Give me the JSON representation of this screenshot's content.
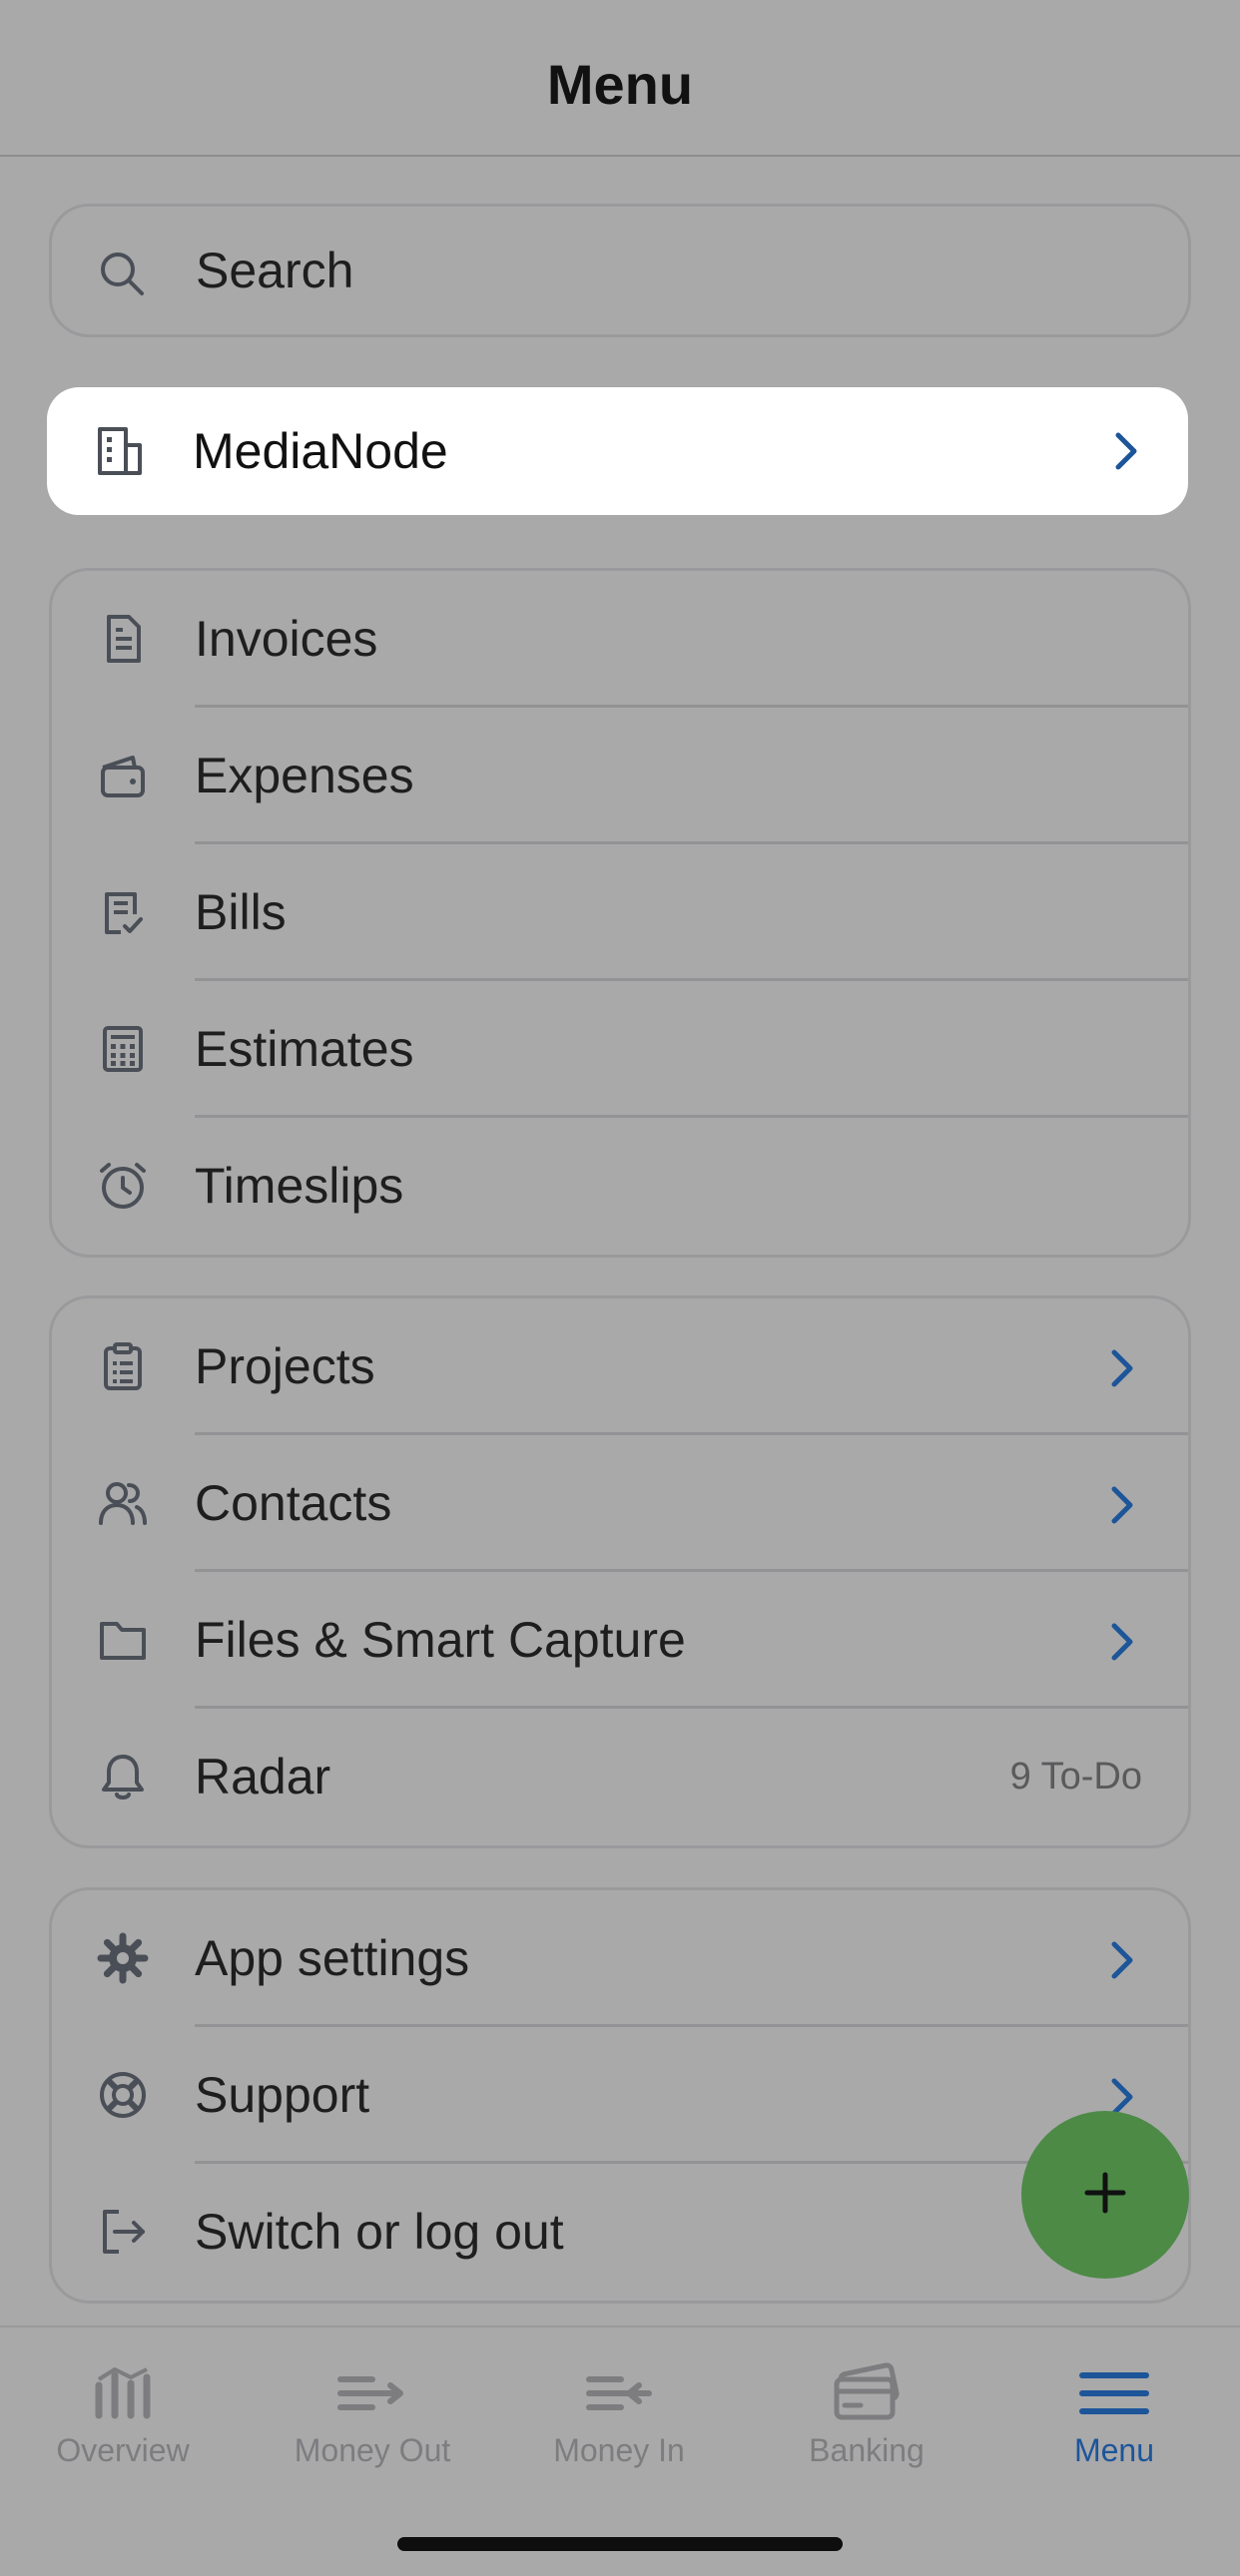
{
  "header": {
    "title": "Menu"
  },
  "search": {
    "label": "Search"
  },
  "organization": {
    "label": "MediaNode"
  },
  "groups": {
    "finance": [
      {
        "label": "Invoices"
      },
      {
        "label": "Expenses"
      },
      {
        "label": "Bills"
      },
      {
        "label": "Estimates"
      },
      {
        "label": "Timeslips"
      }
    ],
    "workspace": [
      {
        "label": "Projects"
      },
      {
        "label": "Contacts"
      },
      {
        "label": "Files & Smart Capture"
      },
      {
        "label": "Radar",
        "trailing": "9 To-Do"
      }
    ],
    "account": [
      {
        "label": "App settings"
      },
      {
        "label": "Support"
      },
      {
        "label": "Switch or log out"
      }
    ]
  },
  "tabs": [
    {
      "label": "Overview"
    },
    {
      "label": "Money Out"
    },
    {
      "label": "Money In"
    },
    {
      "label": "Banking"
    },
    {
      "label": "Menu",
      "active": true
    }
  ],
  "colors": {
    "accent": "#1d5599",
    "fab": "#4c8a46",
    "background": "#a9a9aa",
    "icon": "#4a4f57"
  },
  "icons": {
    "search": "search-icon",
    "organization": "building-icon",
    "invoices": "document-icon",
    "expenses": "wallet-icon",
    "bills": "bill-check-icon",
    "estimates": "calculator-icon",
    "timeslips": "alarm-clock-icon",
    "projects": "clipboard-icon",
    "contacts": "users-icon",
    "files": "folder-icon",
    "radar": "bell-icon",
    "settings": "gear-icon",
    "support": "lifebuoy-icon",
    "logout": "logout-icon",
    "fab": "plus-icon"
  }
}
